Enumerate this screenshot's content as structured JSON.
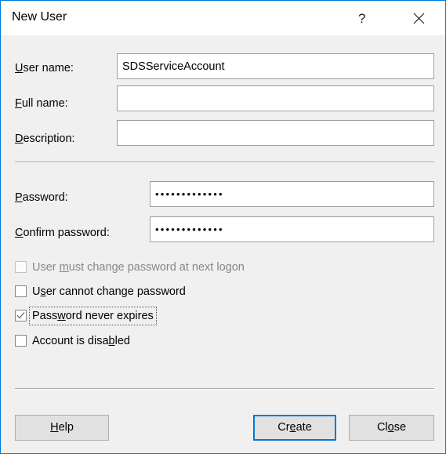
{
  "window": {
    "title": "New User",
    "help_icon": "question-mark-icon",
    "close_icon": "close-icon",
    "accent_color": "#0078d7",
    "body_color": "#f0f0f0",
    "titlebar_color": "#ffffff"
  },
  "fields": [
    {
      "label_prefix": "",
      "label_accel": "U",
      "label_suffix": "ser name:",
      "value": "SDSServiceAccount",
      "placeholder": ""
    },
    {
      "label_prefix": "",
      "label_accel": "F",
      "label_suffix": "ull name:",
      "value": "",
      "placeholder": ""
    },
    {
      "label_prefix": "",
      "label_accel": "D",
      "label_suffix": "escription:",
      "value": "",
      "placeholder": ""
    }
  ],
  "password_fields": [
    {
      "label_prefix": "",
      "label_accel": "P",
      "label_suffix": "assword:",
      "value": "•••••••••••••",
      "placeholder": ""
    },
    {
      "label_prefix": "",
      "label_accel": "C",
      "label_suffix": "onfirm password:",
      "value": "•••••••••••••",
      "placeholder": ""
    }
  ],
  "checkboxes": [
    {
      "label_prefix": "User ",
      "label_accel": "m",
      "label_suffix": "ust change password at next logon",
      "checked": false,
      "disabled": true,
      "focused": false
    },
    {
      "label_prefix": "U",
      "label_accel": "s",
      "label_suffix": "er cannot change password",
      "checked": false,
      "disabled": false,
      "focused": false
    },
    {
      "label_prefix": "Pass",
      "label_accel": "w",
      "label_suffix": "ord never expires",
      "checked": true,
      "disabled": false,
      "focused": true
    },
    {
      "label_prefix": "Account is disa",
      "label_accel": "b",
      "label_suffix": "led",
      "checked": false,
      "disabled": false,
      "focused": false
    }
  ],
  "buttons": [
    {
      "label_prefix": "",
      "label_accel": "H",
      "label_suffix": "elp",
      "default": false
    },
    {
      "label_prefix": "Cr",
      "label_accel": "e",
      "label_suffix": "ate",
      "default": true
    },
    {
      "label_prefix": "Cl",
      "label_accel": "o",
      "label_suffix": "se",
      "default": false
    }
  ]
}
